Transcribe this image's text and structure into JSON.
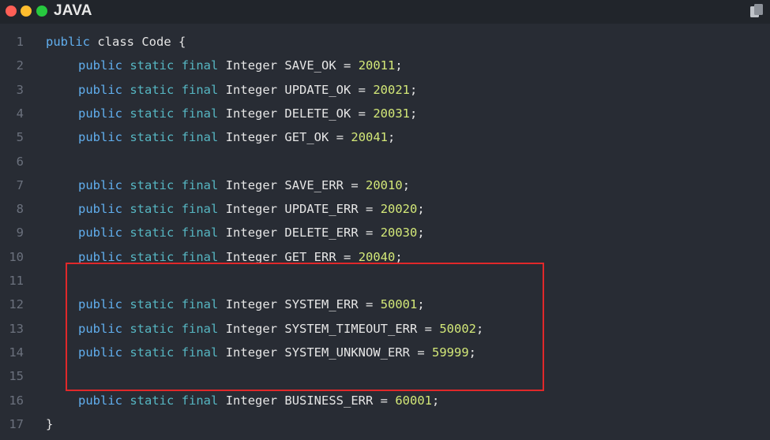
{
  "window": {
    "language": "JAVA",
    "icons": {
      "traffic": [
        "close-dot",
        "minimize-dot",
        "maximize-dot"
      ],
      "copy": "copy-icon"
    }
  },
  "colors": {
    "bg": "#282c34",
    "titlebar": "#21252b",
    "keyword": "#61afef",
    "static": "#56b6c2",
    "final": "#c678dd",
    "number": "#d3e878",
    "highlight": "#e0282a"
  },
  "code": {
    "lines": [
      {
        "no": "1",
        "indent": 0,
        "open": "public class Code {"
      },
      {
        "no": "2",
        "indent": 1,
        "id": "Integer SAVE_OK",
        "val": "20011"
      },
      {
        "no": "3",
        "indent": 1,
        "id": "Integer UPDATE_OK",
        "val": "20021"
      },
      {
        "no": "4",
        "indent": 1,
        "id": "Integer DELETE_OK",
        "val": "20031"
      },
      {
        "no": "5",
        "indent": 1,
        "id": "Integer GET_OK",
        "val": "20041"
      },
      {
        "no": "6",
        "blank": true
      },
      {
        "no": "7",
        "indent": 1,
        "id": "Integer SAVE_ERR",
        "val": "20010"
      },
      {
        "no": "8",
        "indent": 1,
        "id": "Integer UPDATE_ERR",
        "val": "20020"
      },
      {
        "no": "9",
        "indent": 1,
        "id": "Integer DELETE_ERR",
        "val": "20030"
      },
      {
        "no": "10",
        "indent": 1,
        "id": "Integer GET_ERR",
        "val": "20040"
      },
      {
        "no": "11",
        "blank": true
      },
      {
        "no": "12",
        "indent": 1,
        "id": "Integer SYSTEM_ERR",
        "val": "50001"
      },
      {
        "no": "13",
        "indent": 1,
        "id": "Integer SYSTEM_TIMEOUT_ERR",
        "val": "50002"
      },
      {
        "no": "14",
        "indent": 1,
        "id": "Integer SYSTEM_UNKNOW_ERR",
        "val": "59999"
      },
      {
        "no": "15",
        "blank": true
      },
      {
        "no": "16",
        "indent": 1,
        "id": "Integer BUSINESS_ERR",
        "val": "60001"
      },
      {
        "no": "17",
        "close": "}"
      }
    ],
    "tokens": {
      "public": "public",
      "static": "static",
      "final": "final",
      "assign": " = ",
      "end": ";"
    }
  }
}
